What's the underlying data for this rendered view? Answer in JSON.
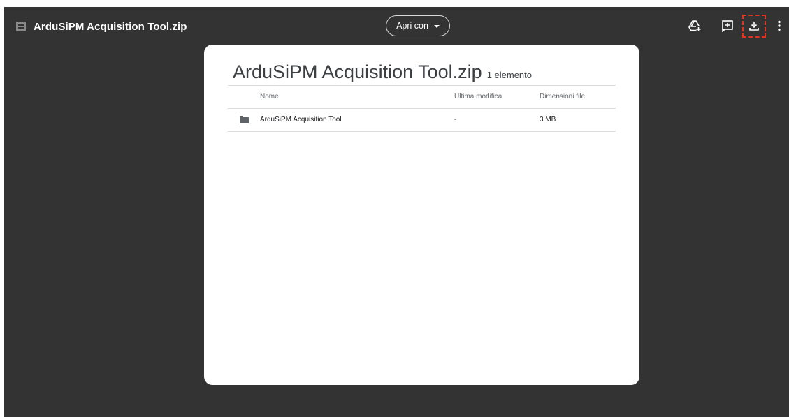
{
  "topbar": {
    "file_name": "ArduSiPM Acquisition Tool.zip",
    "file_icon": "document-icon",
    "open_with_label": "Apri con",
    "actions": [
      {
        "icon": "add-to-drive-icon"
      },
      {
        "icon": "add-comment-icon"
      },
      {
        "icon": "download-icon"
      },
      {
        "icon": "more-vert-icon"
      }
    ],
    "highlight_color": "#e0321e"
  },
  "archive": {
    "title": "ArduSiPM Acquisition Tool.zip",
    "item_count": "1 elemento",
    "columns": {
      "name": "Nome",
      "modified": "Ultima modifica",
      "size": "Dimensioni file"
    },
    "rows": [
      {
        "icon": "folder-icon",
        "name": "ArduSiPM Acquisition Tool",
        "modified": "-",
        "size": "3 MB"
      }
    ]
  },
  "colors": {
    "page_background": "#ffffff",
    "viewer_background": "#333333",
    "card_background": "#ffffff"
  }
}
